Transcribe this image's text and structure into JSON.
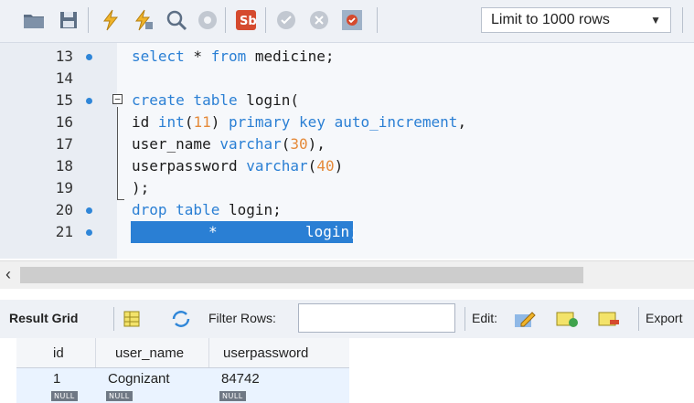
{
  "toolbar": {
    "icons": [
      "folder-icon",
      "save-icon",
      "execute-icon",
      "execute-current-icon",
      "find-icon",
      "stop-icon",
      "toggle-icon",
      "commit-icon",
      "rollback-icon",
      "autocommit-icon"
    ],
    "limit_select": "Limit to 1000 rows"
  },
  "editor": {
    "lines": [
      {
        "num": "13",
        "text": "select * from medicine;"
      },
      {
        "num": "14",
        "text": ""
      },
      {
        "num": "15",
        "text": "create table login("
      },
      {
        "num": "16",
        "text": "id int(11) primary key auto_increment,"
      },
      {
        "num": "17",
        "text": "user_name varchar(30),"
      },
      {
        "num": "18",
        "text": "userpassword varchar(40)"
      },
      {
        "num": "19",
        "text": ");"
      },
      {
        "num": "20",
        "text": "drop table login;"
      },
      {
        "num": "21",
        "text": "*           login;"
      }
    ]
  },
  "result_bar": {
    "tab": "Result Grid",
    "filter_label": "Filter Rows:",
    "edit_label": "Edit:",
    "export_label": "Export"
  },
  "grid": {
    "columns": [
      "id",
      "user_name",
      "userpassword"
    ],
    "rows": [
      [
        "1",
        "Cognizant",
        "84742"
      ]
    ],
    "null_label": "NULL"
  },
  "colors": {
    "keyword": "#2a7fd4",
    "number": "#e58a3a",
    "selection": "#2a7fd4",
    "breakpoint_dot": "#2f86d8"
  }
}
